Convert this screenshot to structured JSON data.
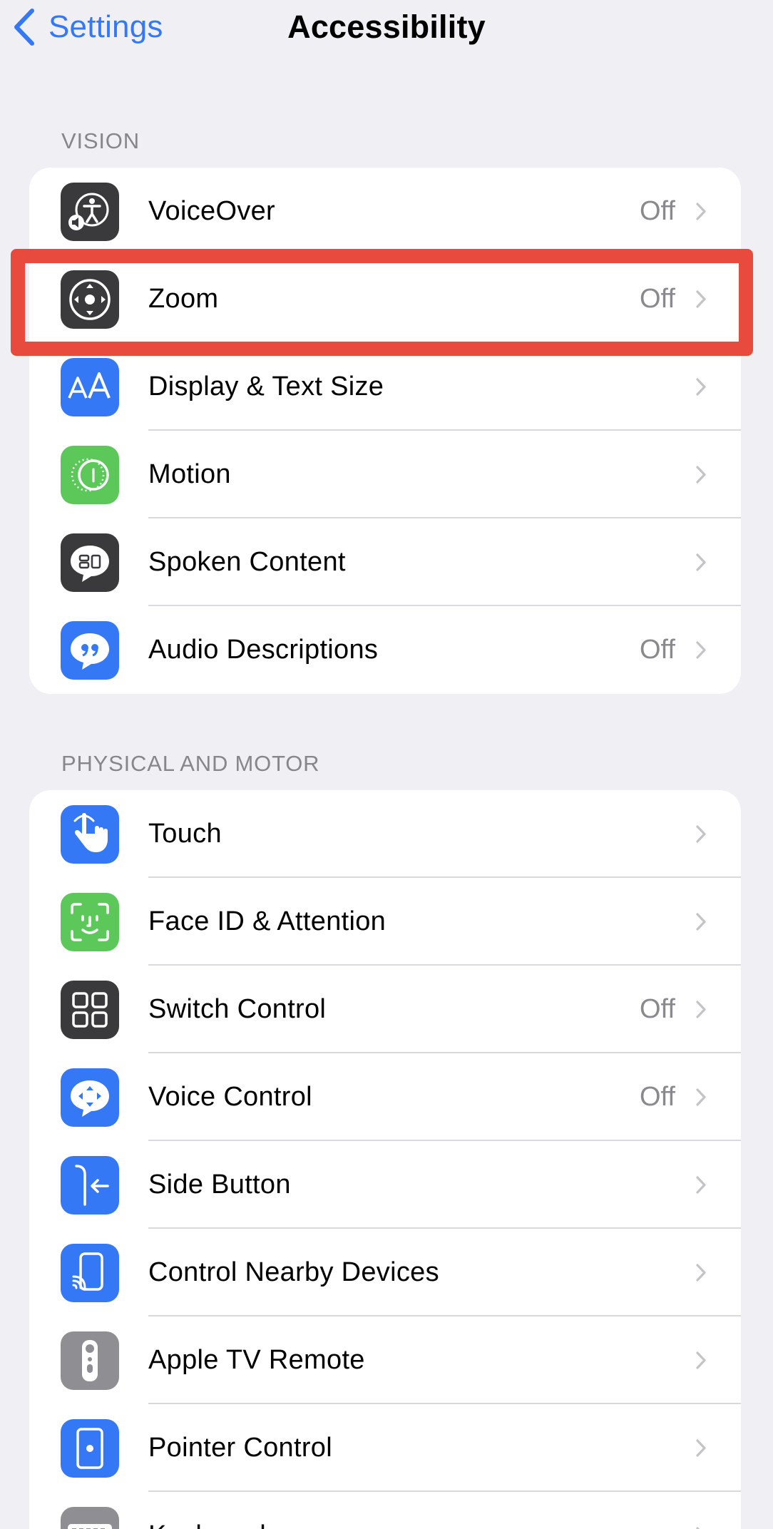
{
  "nav": {
    "back_label": "Settings",
    "title": "Accessibility"
  },
  "colors": {
    "accent": "#3478f6",
    "highlight_box": "#e84a3d",
    "background": "#efeff4"
  },
  "sections": [
    {
      "header": "VISION",
      "items": [
        {
          "label": "VoiceOver",
          "value": "Off",
          "icon": "voiceover-icon",
          "icon_bg": "#3a3a3c"
        },
        {
          "label": "Zoom",
          "value": "Off",
          "icon": "zoom-icon",
          "icon_bg": "#3a3a3c"
        },
        {
          "label": "Display & Text Size",
          "value": "",
          "icon": "display-text-size-icon",
          "icon_bg": "#3478f6"
        },
        {
          "label": "Motion",
          "value": "",
          "icon": "motion-icon",
          "icon_bg": "#5cc85a"
        },
        {
          "label": "Spoken Content",
          "value": "",
          "icon": "spoken-content-icon",
          "icon_bg": "#3a3a3c"
        },
        {
          "label": "Audio Descriptions",
          "value": "Off",
          "icon": "audio-descriptions-icon",
          "icon_bg": "#3478f6"
        }
      ]
    },
    {
      "header": "PHYSICAL AND MOTOR",
      "items": [
        {
          "label": "Touch",
          "value": "",
          "icon": "touch-icon",
          "icon_bg": "#3478f6"
        },
        {
          "label": "Face ID & Attention",
          "value": "",
          "icon": "face-id-icon",
          "icon_bg": "#5cc85a"
        },
        {
          "label": "Switch Control",
          "value": "Off",
          "icon": "switch-control-icon",
          "icon_bg": "#3a3a3c"
        },
        {
          "label": "Voice Control",
          "value": "Off",
          "icon": "voice-control-icon",
          "icon_bg": "#3478f6"
        },
        {
          "label": "Side Button",
          "value": "",
          "icon": "side-button-icon",
          "icon_bg": "#3478f6"
        },
        {
          "label": "Control Nearby Devices",
          "value": "",
          "icon": "control-nearby-devices-icon",
          "icon_bg": "#3478f6"
        },
        {
          "label": "Apple TV Remote",
          "value": "",
          "icon": "apple-tv-remote-icon",
          "icon_bg": "#8e8e93"
        },
        {
          "label": "Pointer Control",
          "value": "",
          "icon": "pointer-control-icon",
          "icon_bg": "#3478f6"
        },
        {
          "label": "Keyboards",
          "value": "",
          "icon": "keyboard-icon",
          "icon_bg": "#8e8e93"
        }
      ]
    }
  ]
}
